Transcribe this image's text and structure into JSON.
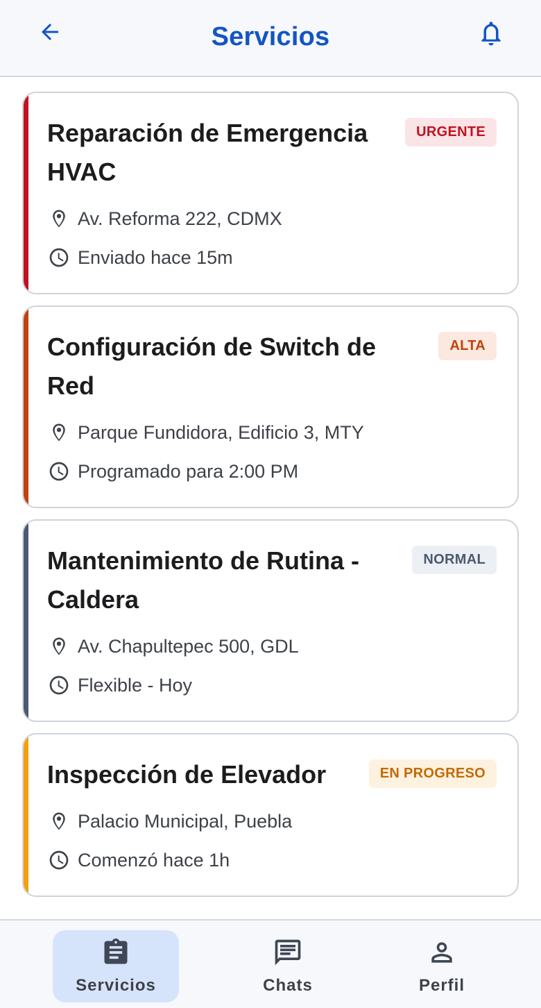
{
  "header": {
    "title": "Servicios",
    "back_icon": "arrow-left-icon",
    "notifications_icon": "bell-icon"
  },
  "colors": {
    "accent": "#1355c4",
    "urgent": "#c1121f",
    "high": "#c2410c",
    "normal": "#4b5a70",
    "in_progress": "#f5a00b"
  },
  "services": [
    {
      "title": "Reparación de Emergencia HVAC",
      "badge": "URGENTE",
      "location": "Av. Reforma 222, CDMX",
      "time": "Enviado hace 15m"
    },
    {
      "title": "Configuración de Switch de Red",
      "badge": "ALTA",
      "location": "Parque Fundidora, Edificio 3, MTY",
      "time": "Programado para 2:00 PM"
    },
    {
      "title": "Mantenimiento de Rutina - Caldera",
      "badge": "NORMAL",
      "location": "Av. Chapultepec 500, GDL",
      "time": "Flexible - Hoy"
    },
    {
      "title": "Inspección de Elevador",
      "badge": "EN PROGRESO",
      "location": "Palacio Municipal, Puebla",
      "time": "Comenzó hace 1h"
    }
  ],
  "nav": {
    "items": [
      {
        "label": "Servicios",
        "icon": "clipboard-icon",
        "active": true
      },
      {
        "label": "Chats",
        "icon": "chat-icon",
        "active": false
      },
      {
        "label": "Perfil",
        "icon": "person-icon",
        "active": false
      }
    ]
  }
}
